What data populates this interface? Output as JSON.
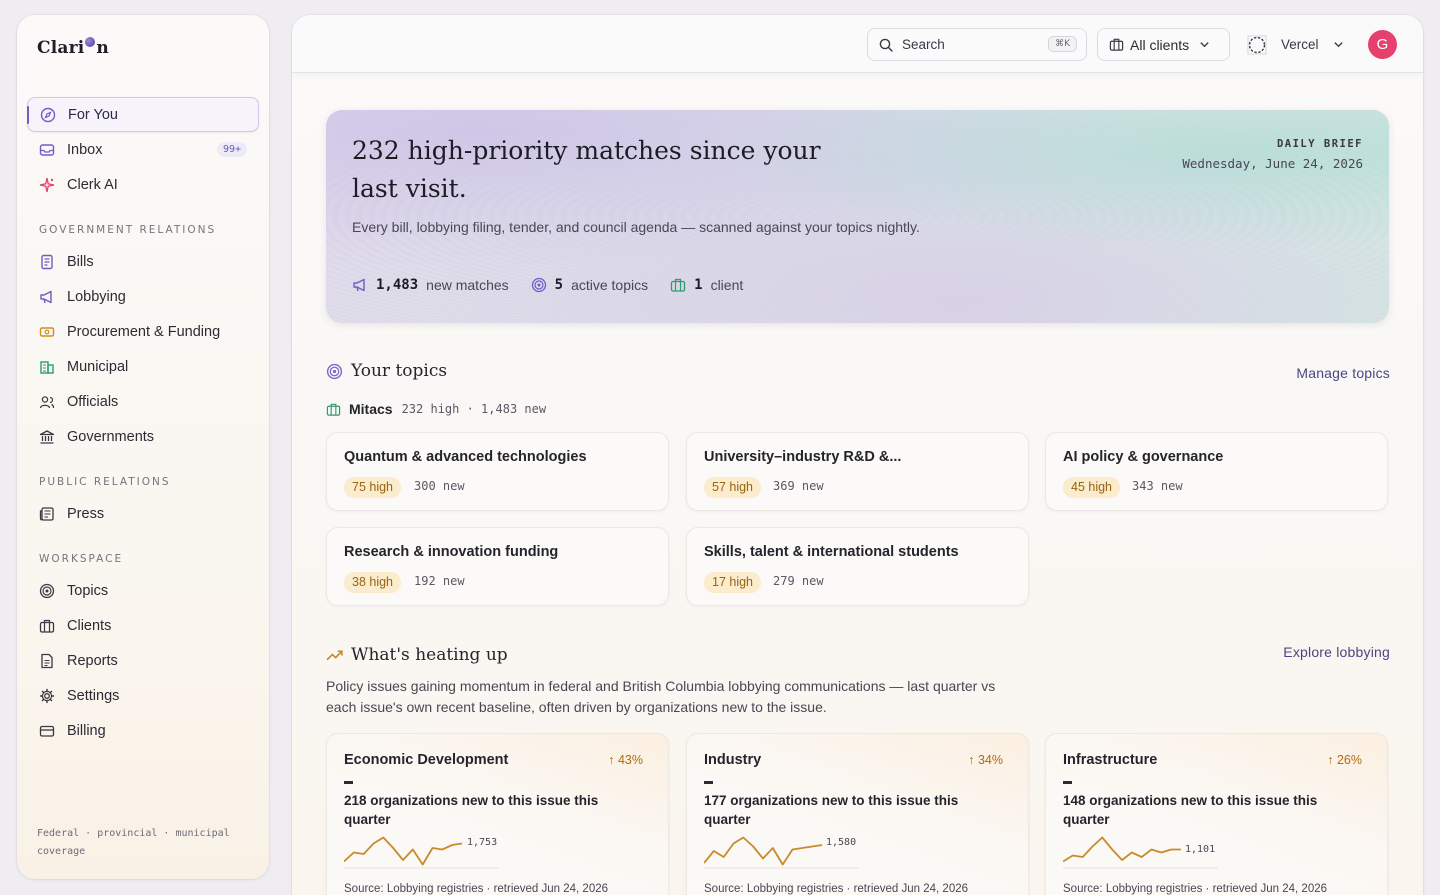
{
  "app": {
    "logo": "Clarion",
    "logo_pre": "Clari",
    "logo_post": "n"
  },
  "sidebar": {
    "primary": [
      {
        "label": "For You",
        "icon": "compass-icon",
        "active": true
      },
      {
        "label": "Inbox",
        "icon": "inbox-icon",
        "badge": "99+"
      },
      {
        "label": "Clerk AI",
        "icon": "sparkle-icon"
      }
    ],
    "sections": [
      {
        "label": "GOVERNMENT RELATIONS",
        "items": [
          {
            "label": "Bills",
            "icon": "scroll-icon"
          },
          {
            "label": "Lobbying",
            "icon": "megaphone-icon"
          },
          {
            "label": "Procurement & Funding",
            "icon": "banknote-icon"
          },
          {
            "label": "Municipal",
            "icon": "building-icon"
          },
          {
            "label": "Officials",
            "icon": "users-icon"
          },
          {
            "label": "Governments",
            "icon": "landmark-icon"
          }
        ]
      },
      {
        "label": "PUBLIC RELATIONS",
        "items": [
          {
            "label": "Press",
            "icon": "newspaper-icon"
          }
        ]
      },
      {
        "label": "WORKSPACE",
        "items": [
          {
            "label": "Topics",
            "icon": "target-icon"
          },
          {
            "label": "Clients",
            "icon": "briefcase-icon"
          },
          {
            "label": "Reports",
            "icon": "file-icon"
          },
          {
            "label": "Settings",
            "icon": "gear-icon"
          },
          {
            "label": "Billing",
            "icon": "card-icon"
          }
        ]
      }
    ],
    "footer_line1": "Federal · provincial · municipal",
    "footer_line2": "coverage"
  },
  "topbar": {
    "search_placeholder": "Search",
    "search_shortcut": "⌘K",
    "clients_label": "All clients",
    "workspace_name": "Vercel",
    "avatar_initial": "G"
  },
  "hero": {
    "title": "232 high-priority matches since your last visit.",
    "subtitle": "Every bill, lobbying filing, tender, and council agenda — scanned against your topics nightly.",
    "brief_label": "DAILY BRIEF",
    "date": "Wednesday, June 24, 2026",
    "stats": [
      {
        "icon": "megaphone-icon",
        "value": "1,483",
        "label": "new matches"
      },
      {
        "icon": "target-icon",
        "value": "5",
        "label": "active topics"
      },
      {
        "icon": "briefcase-icon",
        "value": "1",
        "label": "client"
      }
    ]
  },
  "topics": {
    "title": "Your topics",
    "manage_label": "Manage topics",
    "client_name": "Mitacs",
    "client_meta": "232 high · 1,483 new",
    "cards": [
      {
        "title": "Quantum & advanced technologies",
        "high": "75 high",
        "new": "300 new"
      },
      {
        "title": "University–industry R&D &...",
        "high": "57 high",
        "new": "369 new"
      },
      {
        "title": "AI policy & governance",
        "high": "45 high",
        "new": "343 new"
      },
      {
        "title": "Research & innovation funding",
        "high": "38 high",
        "new": "192 new"
      },
      {
        "title": "Skills, talent & international students",
        "high": "17 high",
        "new": "279 new"
      }
    ]
  },
  "heating": {
    "title": "What's heating up",
    "explore_label": "Explore lobbying",
    "description": "Policy issues gaining momentum in federal and British Columbia lobbying communications — last quarter vs each issue's own recent baseline, often driven by organizations new to the issue.",
    "accent": "#c98a2c",
    "cards": [
      {
        "title": "Economic Development",
        "pct": "↑ 43%",
        "orgs": "218 organizations new to this issue this quarter",
        "peak_label": "1,753",
        "source": "Source: Lobbying registries · retrieved Jun 24, 2026",
        "trend": [
          0.15,
          0.45,
          0.4,
          0.75,
          0.95,
          0.6,
          0.2,
          0.55,
          0.05,
          0.6,
          0.55,
          0.7,
          0.75
        ]
      },
      {
        "title": "Industry",
        "pct": "↑ 34%",
        "orgs": "177 organizations new to this issue this quarter",
        "peak_label": "1,580",
        "source": "Source: Lobbying registries · retrieved Jun 24, 2026",
        "trend": [
          0.1,
          0.5,
          0.3,
          0.75,
          0.95,
          0.65,
          0.25,
          0.6,
          0.05,
          0.55,
          0.6,
          0.65,
          0.7
        ]
      },
      {
        "title": "Infrastructure",
        "pct": "↑ 26%",
        "orgs": "148 organizations new to this issue this quarter",
        "peak_label": "1,101",
        "source": "Source: Lobbying registries · retrieved Jun 24, 2026",
        "trend": [
          0.15,
          0.35,
          0.3,
          0.65,
          0.95,
          0.55,
          0.2,
          0.45,
          0.3,
          0.55,
          0.45,
          0.55,
          0.55
        ]
      }
    ]
  }
}
